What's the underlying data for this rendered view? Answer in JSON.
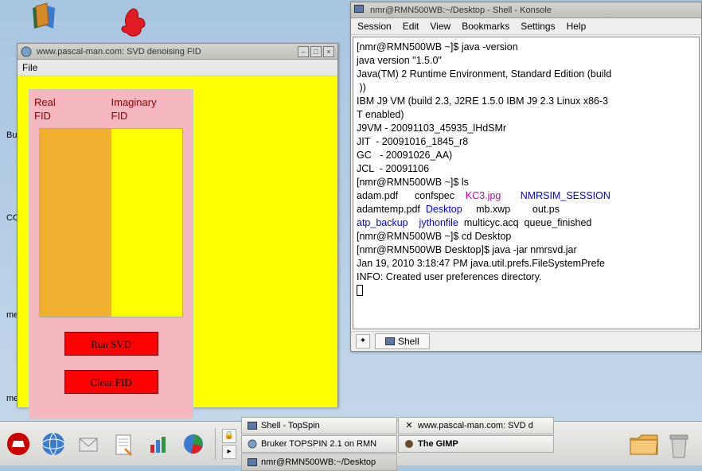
{
  "desktop": {
    "label_bu": "Bu",
    "label_cc": "CC",
    "label_me1": "me",
    "label_me2": "me"
  },
  "svd_window": {
    "title": "www.pascal-man.com: SVD denoising FID",
    "menu_file": "File",
    "real_label_1": "Real",
    "real_label_2": "FID",
    "imag_label_1": "Imaginary",
    "imag_label_2": "FID",
    "run_btn": "Run SVD",
    "clear_btn": "Clear FID"
  },
  "konsole": {
    "title": "nmr@RMN500WB:~/Desktop - Shell - Konsole",
    "menu": {
      "session": "Session",
      "edit": "Edit",
      "view": "View",
      "bookmarks": "Bookmarks",
      "settings": "Settings",
      "help": "Help"
    },
    "tab_label": "Shell",
    "lines": {
      "l01": "[nmr@RMN500WB ~]$ java -version",
      "l02": "java version \"1.5.0\"",
      "l03": "Java(TM) 2 Runtime Environment, Standard Edition (build",
      "l04": " ))",
      "l05": "IBM J9 VM (build 2.3, J2RE 1.5.0 IBM J9 2.3 Linux x86-3",
      "l06": "T enabled)",
      "l07": "J9VM - 20091103_45935_lHdSMr",
      "l08": "JIT  - 20091016_1845_r8",
      "l09": "GC   - 20091026_AA)",
      "l10": "JCL  - 20091106",
      "l11": "[nmr@RMN500WB ~]$ ls",
      "l12a": "adam.pdf      confspec    ",
      "l12b": "KC3.jpg",
      "l12c": "       ",
      "l12d": "NMRSIM_SESSION",
      "l13a": "adamtemp.pdf  ",
      "l13b": "Desktop",
      "l13c": "     mb.xwp        out.ps",
      "l14a": "atp_backup",
      "l14b": "    ",
      "l14c": "jythonfile",
      "l14d": "  multicyc.acq  queue_finished",
      "l15": "[nmr@RMN500WB ~]$ cd Desktop",
      "l16": "[nmr@RMN500WB Desktop]$ java -jar nmrsvd.jar",
      "l17": "Jan 19, 2010 3:18:47 PM java.util.prefs.FileSystemPrefe",
      "l18": "INFO: Created user preferences directory."
    }
  },
  "taskbar": {
    "t_shell_topspin": "Shell - TopSpin",
    "t_pascal": "www.pascal-man.com: SVD d",
    "t_bruker": "Bruker TOPSPIN 2.1 on RMN",
    "t_gimp": "The GIMP",
    "t_konsole": "nmr@RMN500WB:~/Desktop"
  }
}
